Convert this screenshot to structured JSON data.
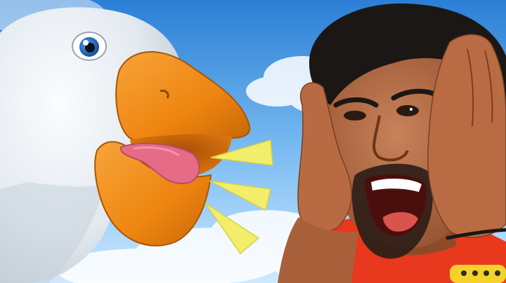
{
  "scene": {
    "kind": "thumbnail",
    "background": "sky with clouds",
    "subjects": [
      "goose-character",
      "shouting-man"
    ]
  },
  "colors": {
    "sky_top": "#2f83d8",
    "sky_bottom": "#bfe3ff",
    "cloud": "#ffffff",
    "goose_body": "#e9eef3",
    "goose_shadow": "#b9c5cf",
    "beak": "#f08a12",
    "beak_dark": "#b35a07",
    "tongue": "#e56b86",
    "burst": "#f3f06b",
    "skin": "#b76b43",
    "skin_dark": "#7a3f22",
    "hair": "#1b1715",
    "shirt": "#e8381d"
  }
}
